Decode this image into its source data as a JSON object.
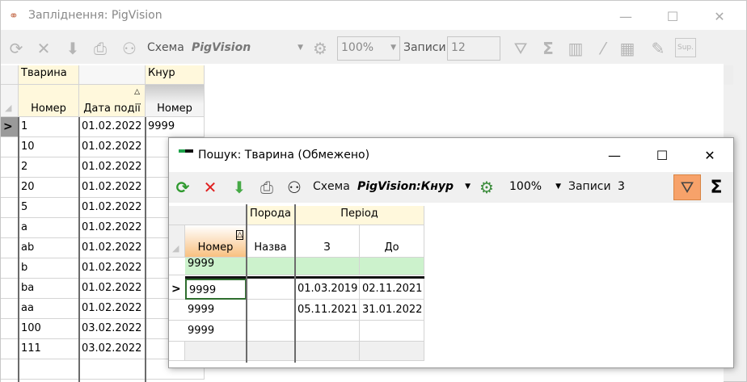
{
  "main_window": {
    "title": "Запліднення: PigVision",
    "toolbar": {
      "schema_label": "Схема",
      "schema_value": "PigVision",
      "zoom_value": "100%",
      "records_label": "Записи",
      "records_value": "12",
      "sup_label": "Sup."
    },
    "grid": {
      "group_headers": [
        "Тварина",
        "",
        "Кнур"
      ],
      "column_headers": [
        "Номер",
        "Дата події",
        "Номер"
      ],
      "rows": [
        {
          "num": "1",
          "date": "01.02.2022",
          "boar": "9999"
        },
        {
          "num": "10",
          "date": "01.02.2022",
          "boar": ""
        },
        {
          "num": "2",
          "date": "01.02.2022",
          "boar": ""
        },
        {
          "num": "20",
          "date": "01.02.2022",
          "boar": ""
        },
        {
          "num": "5",
          "date": "01.02.2022",
          "boar": ""
        },
        {
          "num": "a",
          "date": "01.02.2022",
          "boar": ""
        },
        {
          "num": "ab",
          "date": "01.02.2022",
          "boar": ""
        },
        {
          "num": "b",
          "date": "01.02.2022",
          "boar": ""
        },
        {
          "num": "ba",
          "date": "01.02.2022",
          "boar": ""
        },
        {
          "num": "aa",
          "date": "01.02.2022",
          "boar": ""
        },
        {
          "num": "100",
          "date": "03.02.2022",
          "boar": ""
        },
        {
          "num": "111",
          "date": "03.02.2022",
          "boar": ""
        }
      ],
      "current_row_marker": ">"
    }
  },
  "search_dialog": {
    "title": "Пошук: Тварина (Обмежено)",
    "toolbar": {
      "schema_label": "Схема",
      "schema_value": "PigVision:Кнур",
      "zoom_value": "100%",
      "records_label": "Записи",
      "records_value": "3"
    },
    "grid": {
      "group_headers": [
        "Порода",
        "Період"
      ],
      "column_headers": [
        "Номер",
        "Назва",
        "З",
        "До"
      ],
      "filter_row": {
        "num": "9999"
      },
      "rows": [
        {
          "num": "9999",
          "breed": "",
          "from": "01.03.2019",
          "to": "02.11.2021"
        },
        {
          "num": "9999",
          "breed": "",
          "from": "05.11.2021",
          "to": "31.01.2022"
        },
        {
          "num": "9999",
          "breed": "",
          "from": "",
          "to": ""
        }
      ],
      "current_row_marker": ">"
    }
  }
}
